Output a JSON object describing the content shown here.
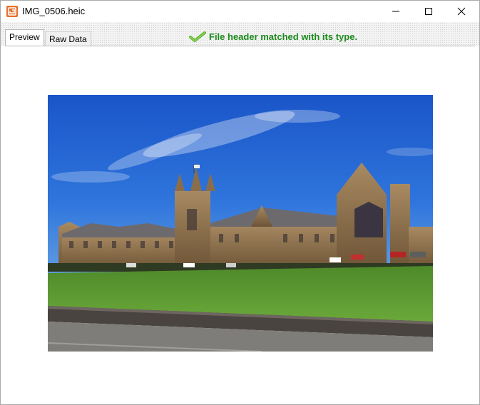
{
  "window": {
    "title": "IMG_0506.heic",
    "app_icon": "app-logo-icon",
    "controls": {
      "minimize": "minimize-icon",
      "maximize": "maximize-icon",
      "close": "close-icon"
    }
  },
  "tabs": [
    {
      "label": "Preview",
      "active": true
    },
    {
      "label": "Raw Data",
      "active": false
    }
  ],
  "status": {
    "message": "File header matched with its type.",
    "icon": "checkmark-icon",
    "color": "#1b8a1b"
  },
  "preview": {
    "image_icon": "photo-preview"
  }
}
